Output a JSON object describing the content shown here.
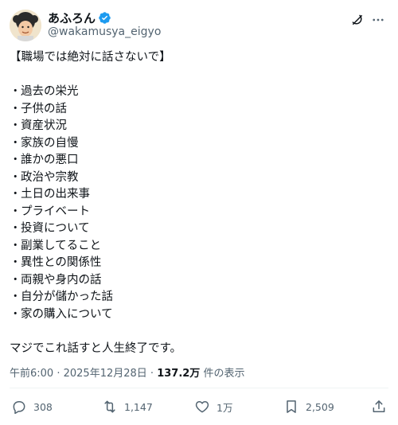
{
  "author": {
    "display_name": "あふろん",
    "handle": "@wakamusya_eigyo"
  },
  "post": {
    "title": "【職場では絶対に話さないで】",
    "bullet_char": "・",
    "items": [
      "過去の栄光",
      "子供の話",
      "資産状況",
      "家族の自慢",
      "誰かの悪口",
      "政治や宗教",
      "土日の出来事",
      "プライベート",
      "投資について",
      "副業してること",
      "異性との関係性",
      "両親や身内の話",
      "自分が儲かった話",
      "家の購入について"
    ],
    "closing": "マジでこれ話すと人生終了です。"
  },
  "meta": {
    "time": "午前6:00",
    "separator": " · ",
    "date": "2025年12月28日",
    "views_count": "137.2万",
    "views_label": " 件の表示"
  },
  "actions": {
    "replies": "308",
    "reposts": "1,147",
    "likes": "1万",
    "bookmarks": "2,509"
  },
  "colors": {
    "text": "#0f1419",
    "secondary": "#536471",
    "verified": "#1d9bf0",
    "divider": "#eff3f4"
  },
  "icons": [
    "verified-badge-icon",
    "grok-icon",
    "more-icon",
    "reply-icon",
    "repost-icon",
    "like-icon",
    "bookmark-icon",
    "share-icon"
  ]
}
